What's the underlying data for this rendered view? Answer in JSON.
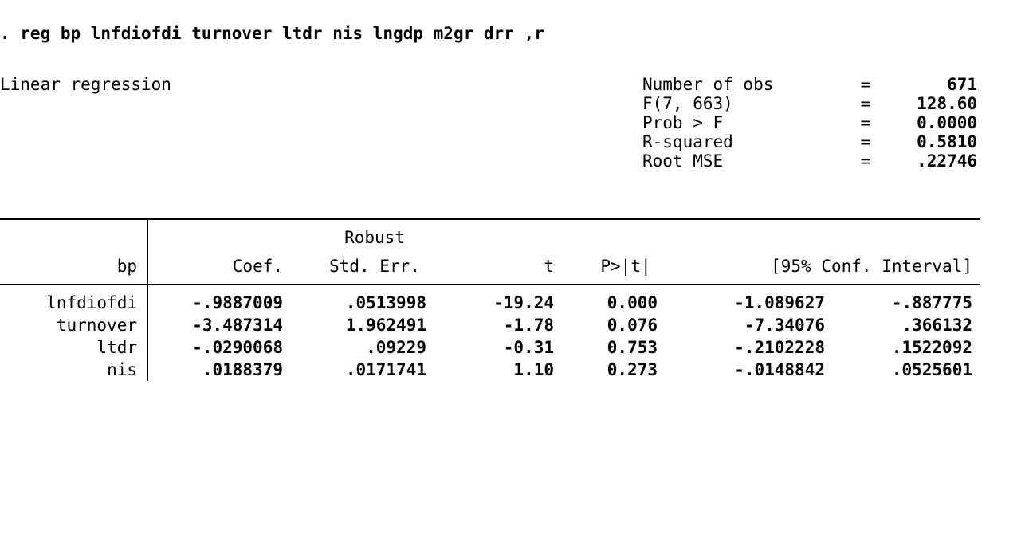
{
  "command": ". reg bp lnfdiofdi turnover ltdr nis lngdp m2gr drr ,r",
  "title": "Linear regression",
  "summary": [
    {
      "label": "Number of obs",
      "value": "671"
    },
    {
      "label": "F(7, 663)",
      "value": "128.60"
    },
    {
      "label": "Prob > F",
      "value": "0.0000"
    },
    {
      "label": "R-squared",
      "value": "0.5810"
    },
    {
      "label": "Root MSE",
      "value": ".22746"
    }
  ],
  "depvar": "bp",
  "header": {
    "coef": "Coef.",
    "robust": "Robust",
    "se": "Std. Err.",
    "t": "t",
    "p": "P>|t|",
    "ci": "[95% Conf. Interval]"
  },
  "rows": [
    {
      "var": "lnfdiofdi",
      "coef": "-.9887009",
      "se": ".0513998",
      "t": "-19.24",
      "p": "0.000",
      "lo": "-1.089627",
      "hi": "-.887775"
    },
    {
      "var": "turnover",
      "coef": "-3.487314",
      "se": "1.962491",
      "t": "-1.78",
      "p": "0.076",
      "lo": "-7.34076",
      "hi": ".366132"
    },
    {
      "var": "ltdr",
      "coef": "-.0290068",
      "se": ".09229",
      "t": "-0.31",
      "p": "0.753",
      "lo": "-.2102228",
      "hi": ".1522092"
    },
    {
      "var": "nis",
      "coef": ".0188379",
      "se": ".0171741",
      "t": "1.10",
      "p": "0.273",
      "lo": "-.0148842",
      "hi": ".0525601"
    }
  ]
}
